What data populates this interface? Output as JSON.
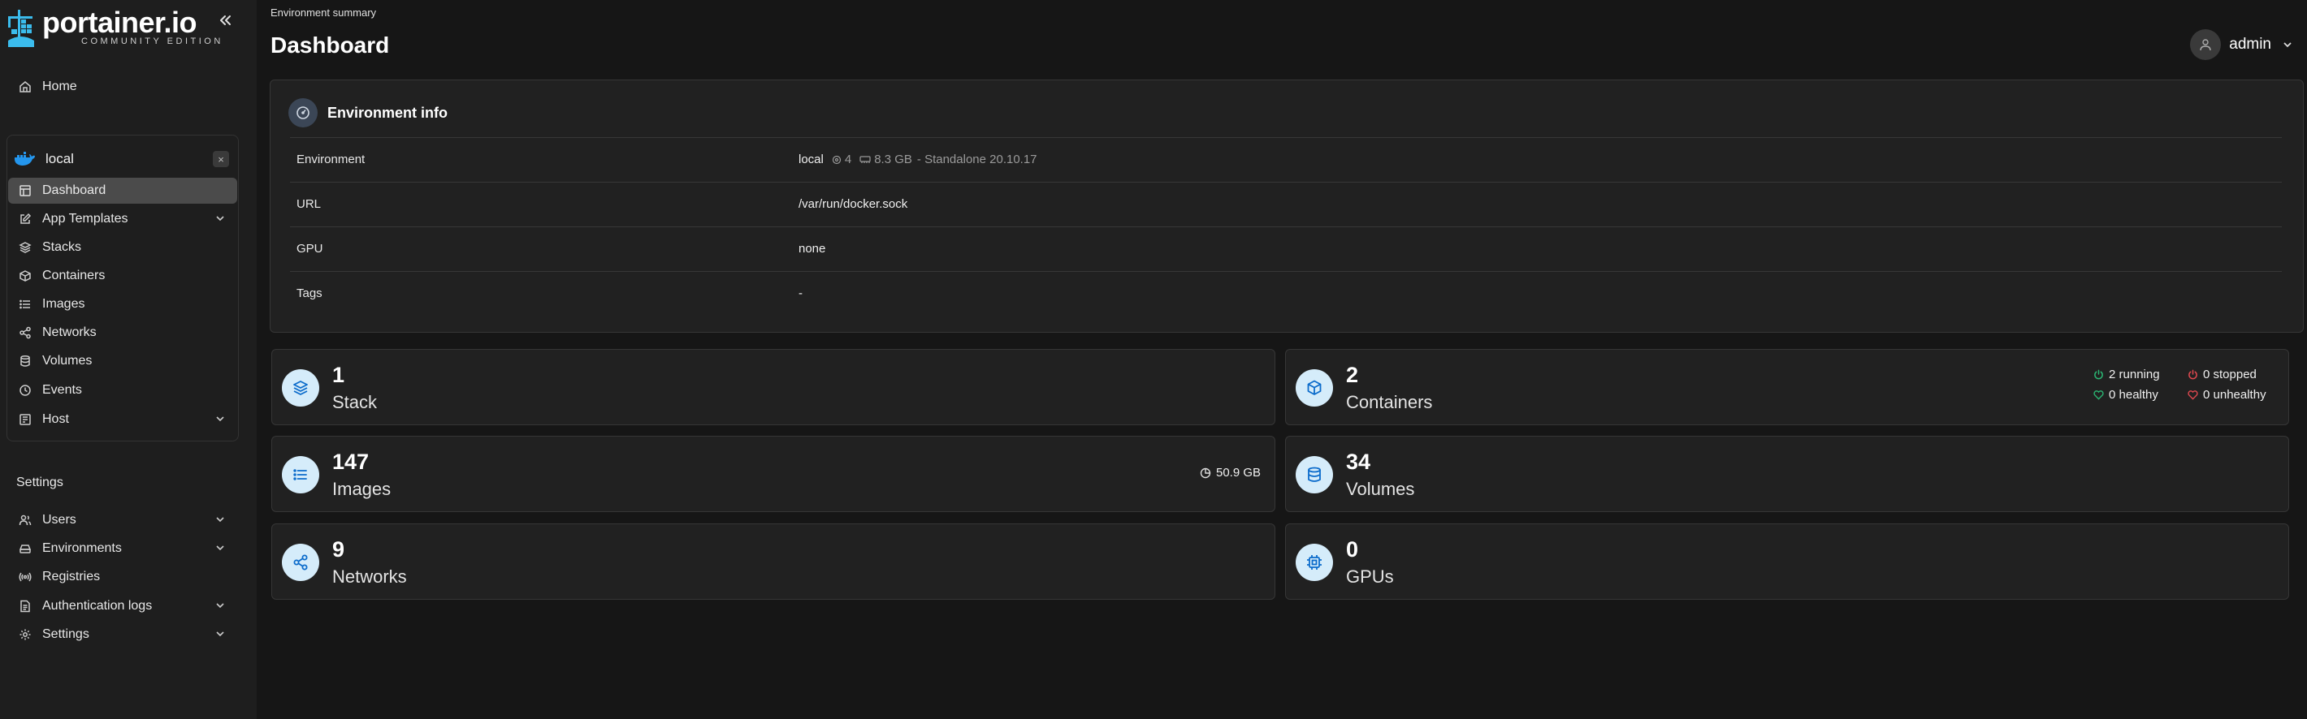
{
  "brand": {
    "name": "portainer.io",
    "edition": "COMMUNITY EDITION"
  },
  "sidebar": {
    "home": "Home",
    "environment": {
      "name": "local",
      "close": "×",
      "items": [
        {
          "label": "Dashboard",
          "icon": "dashboard-icon"
        },
        {
          "label": "App Templates",
          "icon": "edit-icon"
        },
        {
          "label": "Stacks",
          "icon": "layers-icon"
        },
        {
          "label": "Containers",
          "icon": "box-icon"
        },
        {
          "label": "Images",
          "icon": "list-icon"
        },
        {
          "label": "Networks",
          "icon": "share-icon"
        },
        {
          "label": "Volumes",
          "icon": "database-icon"
        },
        {
          "label": "Events",
          "icon": "clock-icon"
        },
        {
          "label": "Host",
          "icon": "host-icon"
        }
      ]
    },
    "settings_section": "Settings",
    "settings_items": [
      {
        "label": "Users"
      },
      {
        "label": "Environments"
      },
      {
        "label": "Registries"
      },
      {
        "label": "Authentication logs"
      },
      {
        "label": "Settings"
      }
    ]
  },
  "header": {
    "breadcrumb": "Environment summary",
    "title": "Dashboard",
    "user": "admin"
  },
  "env_info": {
    "title": "Environment info",
    "rows": [
      {
        "key": "Environment",
        "value": "local",
        "cpu": "4",
        "memory": "8.3 GB",
        "type": "- Standalone 20.10.17"
      },
      {
        "key": "URL",
        "value": "/var/run/docker.sock"
      },
      {
        "key": "GPU",
        "value": "none"
      },
      {
        "key": "Tags",
        "value": "-"
      }
    ]
  },
  "stats": {
    "stack": {
      "num": "1",
      "label": "Stack"
    },
    "containers": {
      "num": "2",
      "label": "Containers",
      "running": "2 running",
      "stopped": "0 stopped",
      "healthy": "0 healthy",
      "unhealthy": "0 unhealthy"
    },
    "images": {
      "num": "147",
      "label": "Images",
      "size": "50.9 GB"
    },
    "volumes": {
      "num": "34",
      "label": "Volumes"
    },
    "networks": {
      "num": "9",
      "label": "Networks"
    },
    "gpus": {
      "num": "0",
      "label": "GPUs"
    }
  },
  "colors": {
    "accent": "#0b6bcb",
    "icon_bg": "#d5ecfa",
    "running": "#2bb673",
    "stopped": "#e0484f"
  }
}
